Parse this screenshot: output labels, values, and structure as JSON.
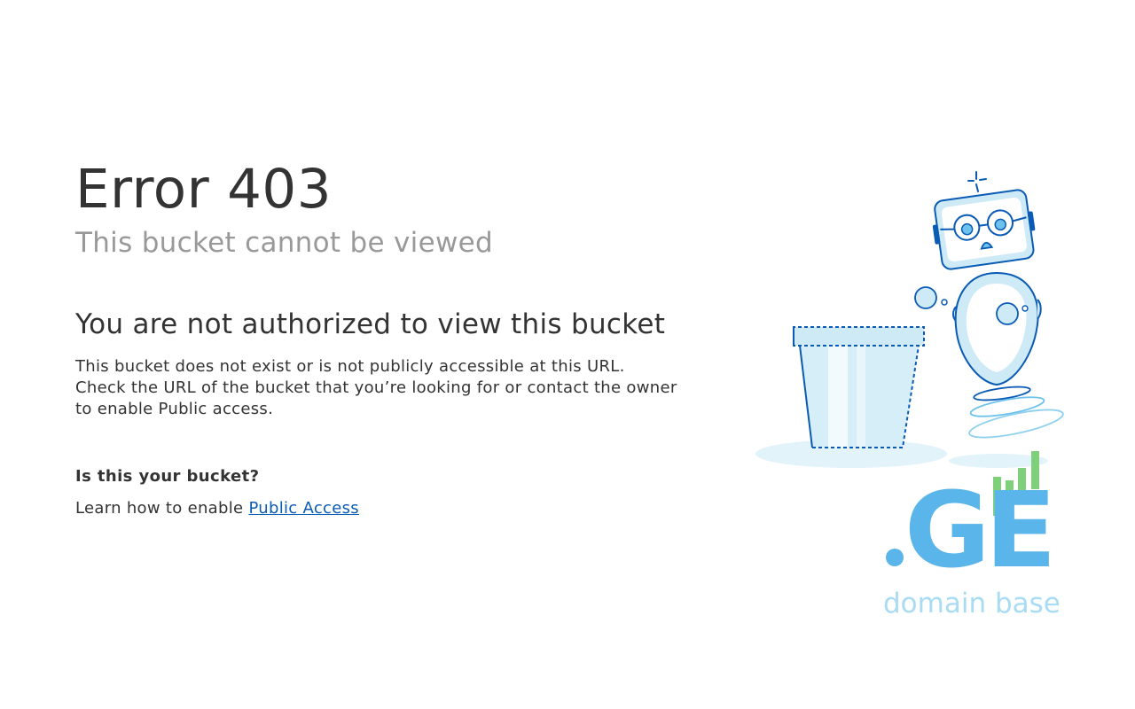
{
  "error": {
    "code": "Error 403",
    "subtitle": "This bucket cannot be viewed"
  },
  "message": {
    "heading": "You are not authorized to view this bucket",
    "description": "This bucket does not exist or is not publicly accessible at this URL. Check the URL of the bucket that you’re looking for or contact the owner to enable Public access."
  },
  "help": {
    "question": "Is this your bucket?",
    "learn_prefix": "Learn how to enable",
    "link_label": "Public Access"
  },
  "logo": {
    "mark": ".GE",
    "tagline": "domain base"
  },
  "colors": {
    "link": "#0a5bb5",
    "logo_blue": "#5ab5ea",
    "logo_green": "#7fd07a",
    "illustration_stroke": "#0a5bb5",
    "illustration_fill": "#cdeaf6"
  }
}
